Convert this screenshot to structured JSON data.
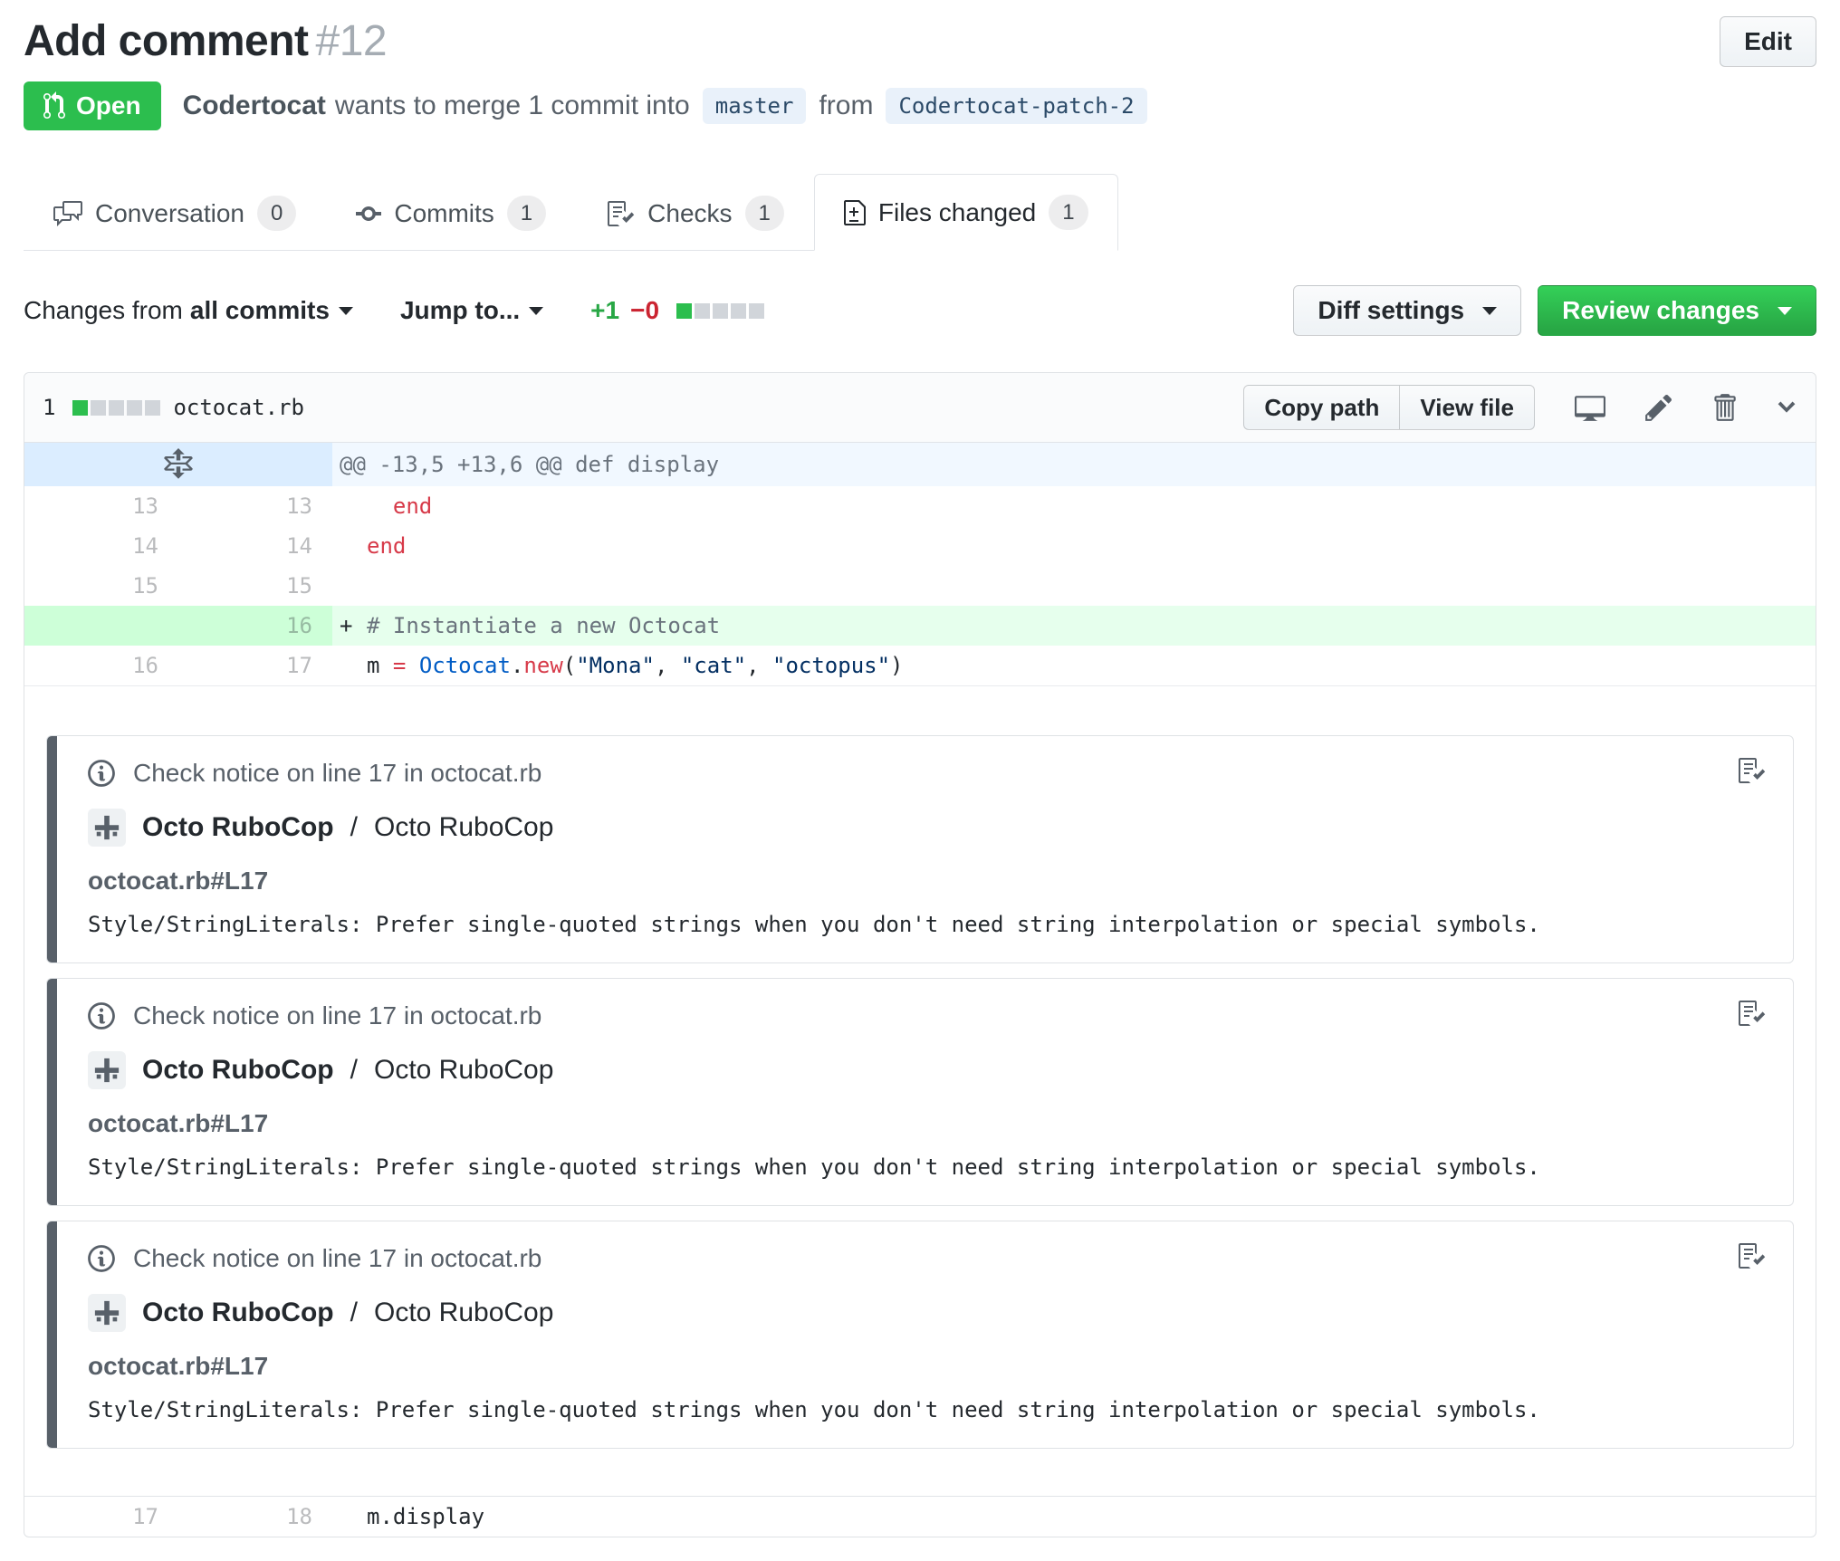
{
  "page": {
    "title": "Add comment",
    "number": "#12",
    "edit_button": "Edit"
  },
  "status": {
    "state": "Open",
    "author": "Codertocat",
    "action": "wants to merge 1 commit into",
    "base_branch": "master",
    "from_label": "from",
    "head_branch": "Codertocat-patch-2"
  },
  "tabs": [
    {
      "label": "Conversation",
      "count": "0",
      "icon": "comment-discussion-icon"
    },
    {
      "label": "Commits",
      "count": "1",
      "icon": "git-commit-icon"
    },
    {
      "label": "Checks",
      "count": "1",
      "icon": "checklist-icon"
    },
    {
      "label": "Files changed",
      "count": "1",
      "icon": "file-diff-icon",
      "active": true
    }
  ],
  "toolbar": {
    "changes_from_label": "Changes from",
    "changes_from_value": "all commits",
    "jump_to_label": "Jump to...",
    "additions": "+1",
    "deletions": "−0",
    "diff_settings_button": "Diff settings",
    "review_changes_button": "Review changes"
  },
  "file": {
    "files_changed_count": "1",
    "filename": "octocat.rb",
    "copy_path_button": "Copy path",
    "view_file_button": "View file",
    "diffstat": {
      "total_blocks": 5,
      "green_blocks": 1
    }
  },
  "diff": {
    "hunk_header": "@@ -13,5 +13,6 @@ def display",
    "rows_before": [
      {
        "old": "13",
        "new": "13",
        "sign": "",
        "type": "context",
        "tokens": [
          {
            "t": "  "
          },
          {
            "t": "end",
            "c": "k"
          }
        ]
      },
      {
        "old": "14",
        "new": "14",
        "sign": "",
        "type": "context",
        "tokens": [
          {
            "t": "end",
            "c": "k"
          }
        ]
      },
      {
        "old": "15",
        "new": "15",
        "sign": "",
        "type": "context",
        "tokens": []
      },
      {
        "old": "",
        "new": "16",
        "sign": "+",
        "type": "add",
        "tokens": [
          {
            "t": "# Instantiate a new Octocat",
            "c": "c"
          }
        ]
      },
      {
        "old": "16",
        "new": "17",
        "sign": "",
        "type": "context",
        "tokens": [
          {
            "t": "m "
          },
          {
            "t": "=",
            "c": "k"
          },
          {
            "t": " "
          },
          {
            "t": "Octocat",
            "c": "v"
          },
          {
            "t": "."
          },
          {
            "t": "new",
            "c": "k"
          },
          {
            "t": "("
          },
          {
            "t": "\"Mona\"",
            "c": "s"
          },
          {
            "t": ", "
          },
          {
            "t": "\"cat\"",
            "c": "s"
          },
          {
            "t": ", "
          },
          {
            "t": "\"octopus\"",
            "c": "s"
          },
          {
            "t": ")"
          }
        ]
      }
    ],
    "rows_after": [
      {
        "old": "17",
        "new": "18",
        "sign": "",
        "type": "context",
        "tokens": [
          {
            "t": "m.display"
          }
        ]
      }
    ]
  },
  "annotations": [
    {
      "header": "Check notice on line 17 in octocat.rb",
      "tool_name": "Octo RuboCop",
      "separator": "/",
      "tool_context": "Octo RuboCop",
      "path": "octocat.rb#L17",
      "message": "Style/StringLiterals: Prefer single-quoted strings when you don't need string interpolation or special symbols."
    },
    {
      "header": "Check notice on line 17 in octocat.rb",
      "tool_name": "Octo RuboCop",
      "separator": "/",
      "tool_context": "Octo RuboCop",
      "path": "octocat.rb#L17",
      "message": "Style/StringLiterals: Prefer single-quoted strings when you don't need string interpolation or special symbols."
    },
    {
      "header": "Check notice on line 17 in octocat.rb",
      "tool_name": "Octo RuboCop",
      "separator": "/",
      "tool_context": "Octo RuboCop",
      "path": "octocat.rb#L17",
      "message": "Style/StringLiterals: Prefer single-quoted strings when you don't need string interpolation or special symbols."
    }
  ],
  "icons": {
    "git-pull-request-icon": "pull request glyph in Open badge",
    "comment-discussion-icon": "two speech bubbles",
    "git-commit-icon": "commit node on line",
    "checklist-icon": "checklist with checkmark",
    "file-diff-icon": "document with plus and minus",
    "unfold-icon": "expand diff arrows",
    "rich-diff-icon": "desktop monitor",
    "edit-file-icon": "pencil",
    "delete-file-icon": "trashcan",
    "collapse-diff-icon": "chevron down",
    "info-icon": "circled i",
    "plus-icon": "avatar plus mark"
  },
  "colors": {
    "open_green": "#2cbe4e",
    "button_green_top": "#34d058",
    "button_green_bottom": "#28a745",
    "addition_green": "#28a745",
    "deletion_red": "#cb2431",
    "add_line_bg": "#e6ffed",
    "add_gutter_bg": "#cdffd8",
    "hunk_bg": "#f1f8ff",
    "hunk_gutter_bg": "#dbedff",
    "keyword": "#d73a49",
    "constant": "#005cc5",
    "string": "#032f62",
    "comment": "#6a737d"
  }
}
